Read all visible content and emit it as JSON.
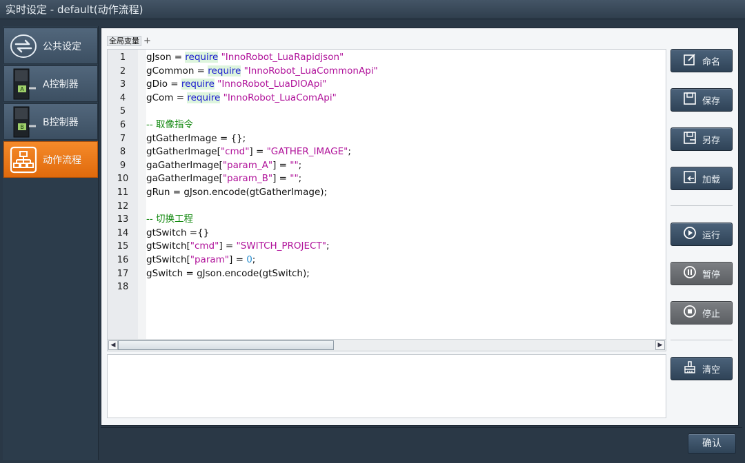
{
  "window": {
    "title": "实时设定 - default(动作流程)"
  },
  "sidebar": {
    "items": [
      {
        "label": "公共设定",
        "icon": "sync-arrows-icon"
      },
      {
        "label": "A控制器",
        "icon": "controller-a-icon"
      },
      {
        "label": "B控制器",
        "icon": "controller-b-icon"
      },
      {
        "label": "动作流程",
        "icon": "flowchart-icon",
        "active": true
      }
    ]
  },
  "tabs": {
    "label": "全局变量",
    "add": "+"
  },
  "editor": {
    "line_numbers": [
      "1",
      "2",
      "3",
      "4",
      "5",
      "6",
      "7",
      "8",
      "9",
      "10",
      "11",
      "12",
      "13",
      "14",
      "15",
      "16",
      "17",
      "18"
    ],
    "lines": [
      [
        "gJson = ",
        "require",
        " ",
        "\"InnoRobot_LuaRapidjson\""
      ],
      [
        "gCommon = ",
        "require",
        " ",
        "\"InnoRobot_LuaCommonApi\""
      ],
      [
        "gDio = ",
        "require",
        " ",
        "\"InnoRobot_LuaDIOApi\""
      ],
      [
        "gCom = ",
        "require",
        " ",
        "\"InnoRobot_LuaComApi\""
      ],
      "",
      "-- 取像指令",
      "gtGatherImage = {};",
      [
        "gtGatherImage[",
        "\"cmd\"",
        "] = ",
        "\"GATHER_IMAGE\"",
        ";"
      ],
      [
        "gaGatherImage[",
        "\"param_A\"",
        "] = ",
        "\"\"",
        ";"
      ],
      [
        "gaGatherImage[",
        "\"param_B\"",
        "] = ",
        "\"\"",
        ";"
      ],
      "gRun = gJson.encode(gtGatherImage);",
      "",
      "-- 切换工程",
      "gtSwitch ={}",
      [
        "gtSwitch[",
        "\"cmd\"",
        "] = ",
        "\"SWITCH_PROJECT\"",
        ";"
      ],
      [
        "gtSwitch[",
        "\"param\"",
        "] = ",
        "0",
        ";"
      ],
      "gSwitch = gJson.encode(gtSwitch);",
      ""
    ]
  },
  "buttons": {
    "rename": "命名",
    "save": "保存",
    "save_as": "另存",
    "load": "加载",
    "run": "运行",
    "pause": "暂停",
    "stop": "停止",
    "clear": "清空",
    "confirm": "确认"
  },
  "colors": {
    "active_nav": "#f07a1a",
    "button": "#3e546a",
    "keyword": "#1a1ad0",
    "string": "#b0129a",
    "comment": "#11880e"
  }
}
